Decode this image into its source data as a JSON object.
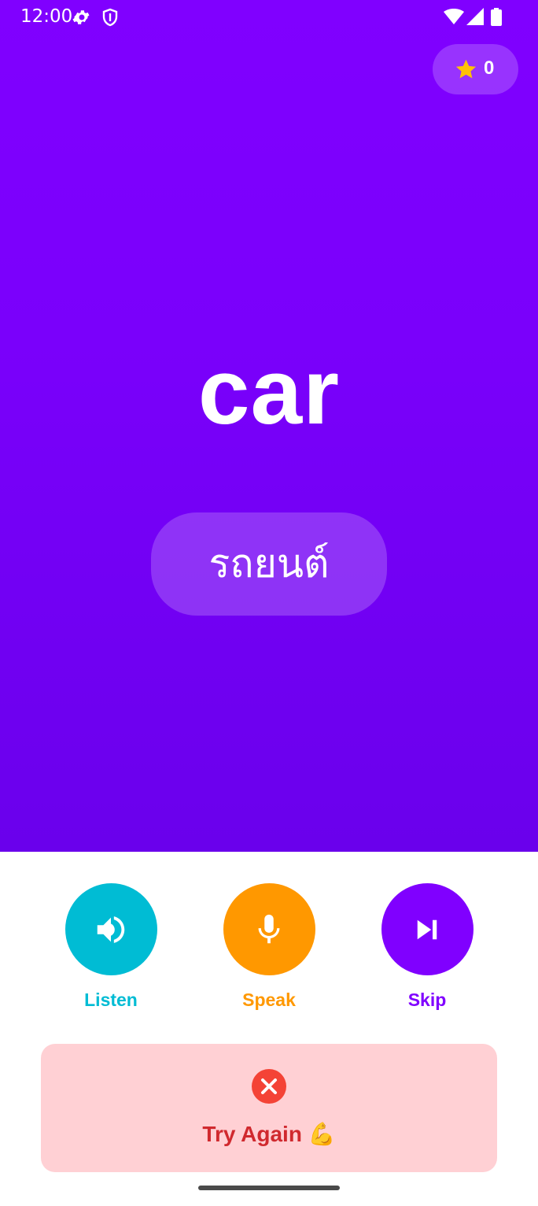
{
  "status_bar": {
    "time": "12:00"
  },
  "score": {
    "value": "0"
  },
  "card": {
    "word": "car",
    "translation": "รถยนต์"
  },
  "controls": {
    "listen_label": "Listen",
    "speak_label": "Speak",
    "skip_label": "Skip"
  },
  "feedback": {
    "message": "Try Again 💪"
  },
  "colors": {
    "primary": "#8000ff",
    "listen": "#00bcd4",
    "speak": "#ff9800",
    "skip": "#8000ff",
    "error_bg": "#ffd0d4",
    "error_text": "#d0292e",
    "error_icon": "#f44336",
    "star": "#ffc107"
  }
}
